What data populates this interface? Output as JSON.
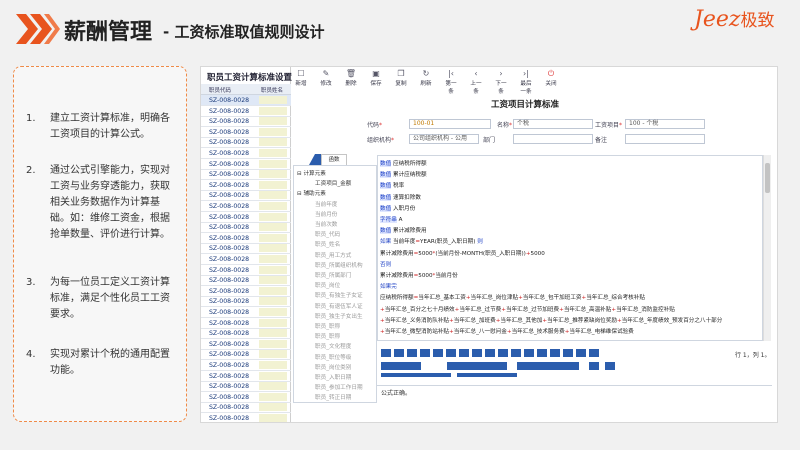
{
  "slide": {
    "title": "薪酬管理",
    "subtitle": "- 工资标准取值规则设计",
    "logo": {
      "latin": "Jeez",
      "cn": "极致"
    },
    "colors": {
      "accent": "#e8541e",
      "panel_border": "#ef8a47",
      "chevron": "#e8541e"
    }
  },
  "points": [
    {
      "num": "1.",
      "text": "建立工资计算标准，明确各工资项目的计算公式。"
    },
    {
      "num": "2.",
      "text": "通过公式引擎能力，实现对工资与业务穿透能力，获取相关业务数据作为计算基础。如：维修工资金，根据抢单数量、评价进行计算。"
    },
    {
      "num": "3.",
      "text": "为每一位员工定义工资计算标准，满足个性化员工工资要求。"
    },
    {
      "num": "4.",
      "text": "实现对累计个税的通用配置功能。"
    }
  ],
  "app": {
    "list_title": "职员工资计算标准设置",
    "list_cols": [
      "职员代码",
      "职员姓名"
    ],
    "list_rows": [
      "SZ-008-0028",
      "SZ-008-0028",
      "SZ-008-0028",
      "SZ-008-0028",
      "SZ-008-0028",
      "SZ-008-0028",
      "SZ-008-0028",
      "SZ-008-0028",
      "SZ-008-0028",
      "SZ-008-0028",
      "SZ-008-0028",
      "SZ-008-0028",
      "SZ-008-0028",
      "SZ-008-0028",
      "SZ-008-0028",
      "SZ-008-0028",
      "SZ-008-0028",
      "SZ-008-0028",
      "SZ-008-0028",
      "SZ-008-0028",
      "SZ-008-0028",
      "SZ-008-0028",
      "SZ-008-0028",
      "SZ-008-0028",
      "SZ-008-0028",
      "SZ-008-0028",
      "SZ-008-0028",
      "SZ-008-0028",
      "SZ-008-0028",
      "SZ-008-0028",
      "SZ-008-0028"
    ],
    "toolbar": [
      {
        "label": "新增",
        "icon": "new-icon",
        "glyph": "☐"
      },
      {
        "label": "修改",
        "icon": "edit-icon",
        "glyph": "✎"
      },
      {
        "label": "删除",
        "icon": "delete-icon",
        "glyph": "🗑"
      },
      {
        "label": "保存",
        "icon": "save-icon",
        "glyph": "▣"
      },
      {
        "label": "复制",
        "icon": "copy-icon",
        "glyph": "❐"
      },
      {
        "label": "刷新",
        "icon": "refresh-icon",
        "glyph": "↻"
      },
      {
        "label": "第一条",
        "icon": "first-icon",
        "glyph": "|‹"
      },
      {
        "label": "上一条",
        "icon": "prev-icon",
        "glyph": "‹"
      },
      {
        "label": "下一条",
        "icon": "next-icon",
        "glyph": "›"
      },
      {
        "label": "最后一条",
        "icon": "last-icon",
        "glyph": "›|"
      },
      {
        "label": "关闭",
        "icon": "close-icon",
        "glyph": "⏻"
      }
    ],
    "form_title": "工资项目计算标准",
    "fields": {
      "code_label": "代码",
      "code_value": "100-01",
      "name_label": "名称",
      "name_value": "个税",
      "item_label": "工资项目",
      "item_value": "100 - 个税",
      "org_label": "组织机构",
      "org_value": "公司组织机构 - 公用",
      "dept_label": "部门",
      "dept_value": "",
      "note_label": "备注",
      "note_value": ""
    },
    "tab_label": "函数",
    "tree": [
      {
        "t": "⊟ 计算元素",
        "ind": 0,
        "g": false
      },
      {
        "t": "工资项目_金额",
        "ind": 1,
        "g": false
      },
      {
        "t": "⊟ 辅助元素",
        "ind": 0,
        "g": false
      },
      {
        "t": "当前年度",
        "ind": 1,
        "g": true
      },
      {
        "t": "当前月份",
        "ind": 1,
        "g": true
      },
      {
        "t": "当前次数",
        "ind": 1,
        "g": true
      },
      {
        "t": "职员_代码",
        "ind": 1,
        "g": true
      },
      {
        "t": "职员_姓名",
        "ind": 1,
        "g": true
      },
      {
        "t": "职员_用工方式",
        "ind": 1,
        "g": true
      },
      {
        "t": "职员_所属组织机构",
        "ind": 1,
        "g": true
      },
      {
        "t": "职员_所属部门",
        "ind": 1,
        "g": true
      },
      {
        "t": "职员_岗位",
        "ind": 1,
        "g": true
      },
      {
        "t": "职员_有独生子女证",
        "ind": 1,
        "g": true
      },
      {
        "t": "职员_有退伍军人证",
        "ind": 1,
        "g": true
      },
      {
        "t": "职员_独生子女出生",
        "ind": 1,
        "g": true
      },
      {
        "t": "职员_职称",
        "ind": 1,
        "g": true
      },
      {
        "t": "职员_职称",
        "ind": 1,
        "g": true
      },
      {
        "t": "职员_文化程度",
        "ind": 1,
        "g": true
      },
      {
        "t": "职员_职位等级",
        "ind": 1,
        "g": true
      },
      {
        "t": "职员_岗位类别",
        "ind": 1,
        "g": true
      },
      {
        "t": "职员_入职日期",
        "ind": 1,
        "g": true
      },
      {
        "t": "职员_参加工作日期",
        "ind": 1,
        "g": true
      },
      {
        "t": "职员_转正日期",
        "ind": 1,
        "g": true
      }
    ],
    "code_lines": [
      [
        {
          "k": "kw",
          "t": "数值"
        },
        {
          "k": "",
          "t": " 应纳税所得额"
        }
      ],
      [
        {
          "k": "kw",
          "t": "数值"
        },
        {
          "k": "",
          "t": " 累计应纳税额"
        }
      ],
      [
        {
          "k": "kw",
          "t": "数值"
        },
        {
          "k": "",
          "t": " 税率"
        }
      ],
      [
        {
          "k": "kw",
          "t": "数值"
        },
        {
          "k": "",
          "t": " 速算扣除数"
        }
      ],
      [
        {
          "k": "kw",
          "t": "数值"
        },
        {
          "k": "",
          "t": " 入职月份"
        }
      ],
      [
        {
          "k": "kw",
          "t": "字符串"
        },
        {
          "k": "",
          "t": " A"
        }
      ],
      [
        {
          "k": "kw",
          "t": "数值"
        },
        {
          "k": "",
          "t": " 累计减除费用"
        }
      ],
      [
        {
          "k": "kw2",
          "t": "如果"
        },
        {
          "k": "",
          "t": " 当前年度"
        },
        {
          "k": "red",
          "t": "="
        },
        {
          "k": "",
          "t": "YEAR(职员_入职日期) "
        },
        {
          "k": "kw2",
          "t": "则"
        }
      ],
      [
        {
          "k": "",
          "t": "      累计减除费用"
        },
        {
          "k": "red",
          "t": "="
        },
        {
          "k": "",
          "t": "5000"
        },
        {
          "k": "red",
          "t": "*"
        },
        {
          "k": "",
          "t": "(当前月份-MONTH(职员_入职日期))"
        },
        {
          "k": "red",
          "t": "+"
        },
        {
          "k": "",
          "t": "5000"
        }
      ],
      [
        {
          "k": "kw2",
          "t": "否则"
        }
      ],
      [
        {
          "k": "",
          "t": "      累计减除费用"
        },
        {
          "k": "red",
          "t": "="
        },
        {
          "k": "",
          "t": "5000"
        },
        {
          "k": "red",
          "t": "*"
        },
        {
          "k": "",
          "t": "当前月份"
        }
      ],
      [
        {
          "k": "kw2",
          "t": "如果完"
        }
      ],
      [
        {
          "k": "",
          "t": "应纳税所得额"
        },
        {
          "k": "red",
          "t": "="
        },
        {
          "k": "",
          "t": "当年汇总_基本工资"
        },
        {
          "k": "red",
          "t": "+"
        },
        {
          "k": "",
          "t": "当年汇总_岗位津贴"
        },
        {
          "k": "red",
          "t": "+"
        },
        {
          "k": "",
          "t": "当年汇总_包干加班工资"
        },
        {
          "k": "red",
          "t": "+"
        },
        {
          "k": "",
          "t": "当年汇总_综合考核补贴"
        }
      ],
      [
        {
          "k": "red",
          "t": "+"
        },
        {
          "k": "",
          "t": "当年汇总_百分之七十月绩效"
        },
        {
          "k": "red",
          "t": "+"
        },
        {
          "k": "",
          "t": "当年汇总_过节费"
        },
        {
          "k": "red",
          "t": "+"
        },
        {
          "k": "",
          "t": "当年汇总_过节加班费"
        },
        {
          "k": "red",
          "t": "+"
        },
        {
          "k": "",
          "t": "当年汇总_高温补贴"
        },
        {
          "k": "red",
          "t": "+"
        },
        {
          "k": "",
          "t": "当年汇总_消防监控补贴"
        }
      ],
      [
        {
          "k": "red",
          "t": "+"
        },
        {
          "k": "",
          "t": "当年汇总_义务消防队补贴"
        },
        {
          "k": "red",
          "t": "+"
        },
        {
          "k": "",
          "t": "当年汇总_加班费"
        },
        {
          "k": "red",
          "t": "+"
        },
        {
          "k": "",
          "t": "当年汇总_其他加"
        },
        {
          "k": "red",
          "t": "+"
        },
        {
          "k": "",
          "t": "当年汇总_推荐紧缺岗位奖励"
        },
        {
          "k": "red",
          "t": "+"
        },
        {
          "k": "",
          "t": "当年汇总_年度绩效_预发百分之八十部分"
        }
      ],
      [
        {
          "k": "red",
          "t": "+"
        },
        {
          "k": "",
          "t": "当年汇总_微型消防站补贴"
        },
        {
          "k": "red",
          "t": "+"
        },
        {
          "k": "",
          "t": "当年汇总_八一慰问金"
        },
        {
          "k": "red",
          "t": "+"
        },
        {
          "k": "",
          "t": "当年汇总_技术服务费"
        },
        {
          "k": "red",
          "t": "+"
        },
        {
          "k": "",
          "t": "当年汇总_电梯维保试验费"
        }
      ]
    ],
    "position": "行 1，列 1。",
    "formula_label": "公式正确。"
  }
}
